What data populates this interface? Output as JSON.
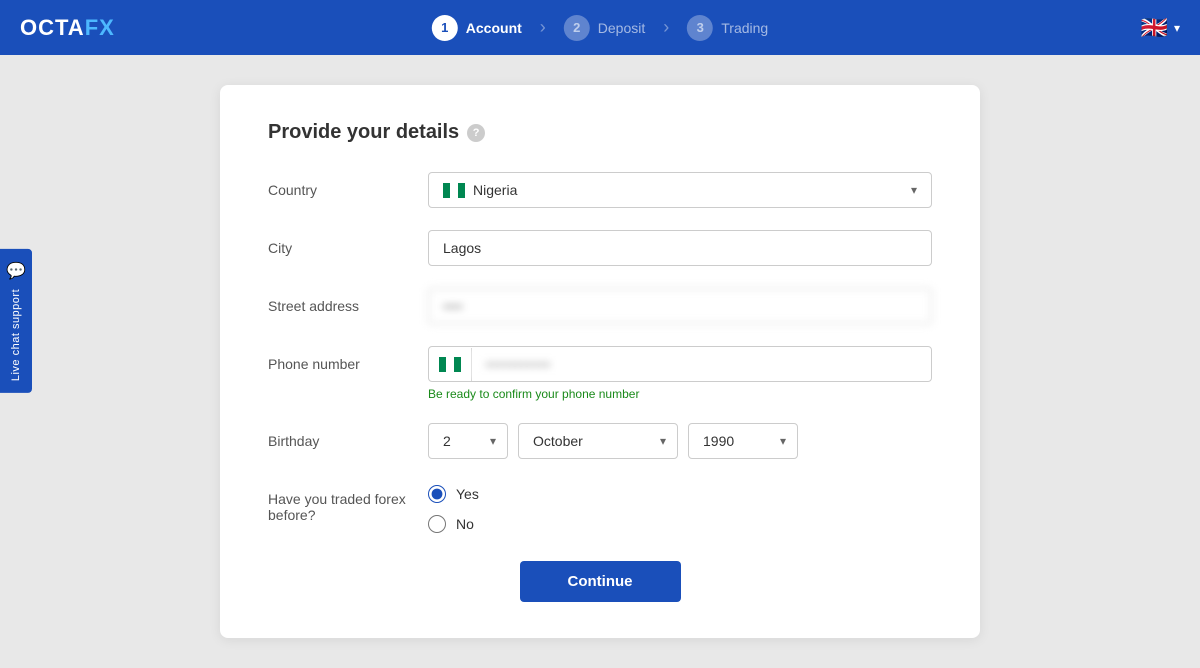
{
  "header": {
    "logo": "OCTAFX",
    "steps": [
      {
        "num": "1",
        "label": "Account",
        "active": true
      },
      {
        "num": "2",
        "label": "Deposit",
        "active": false
      },
      {
        "num": "3",
        "label": "Trading",
        "active": false
      }
    ]
  },
  "live_chat": {
    "label": "Live chat support",
    "icon": "💬"
  },
  "form": {
    "title": "Provide your details",
    "fields": {
      "country_label": "Country",
      "country_value": "Nigeria",
      "city_label": "City",
      "city_value": "Lagos",
      "street_label": "Street address",
      "street_placeholder": "••",
      "phone_label": "Phone number",
      "phone_hint": "Be ready to confirm your phone number",
      "birthday_label": "Birthday",
      "birthday_day": "2",
      "birthday_month": "October",
      "birthday_year": "1990",
      "forex_label_line1": "Have you traded forex",
      "forex_label_line2": "before?",
      "forex_yes": "Yes",
      "forex_no": "No"
    },
    "continue_button": "Continue"
  }
}
